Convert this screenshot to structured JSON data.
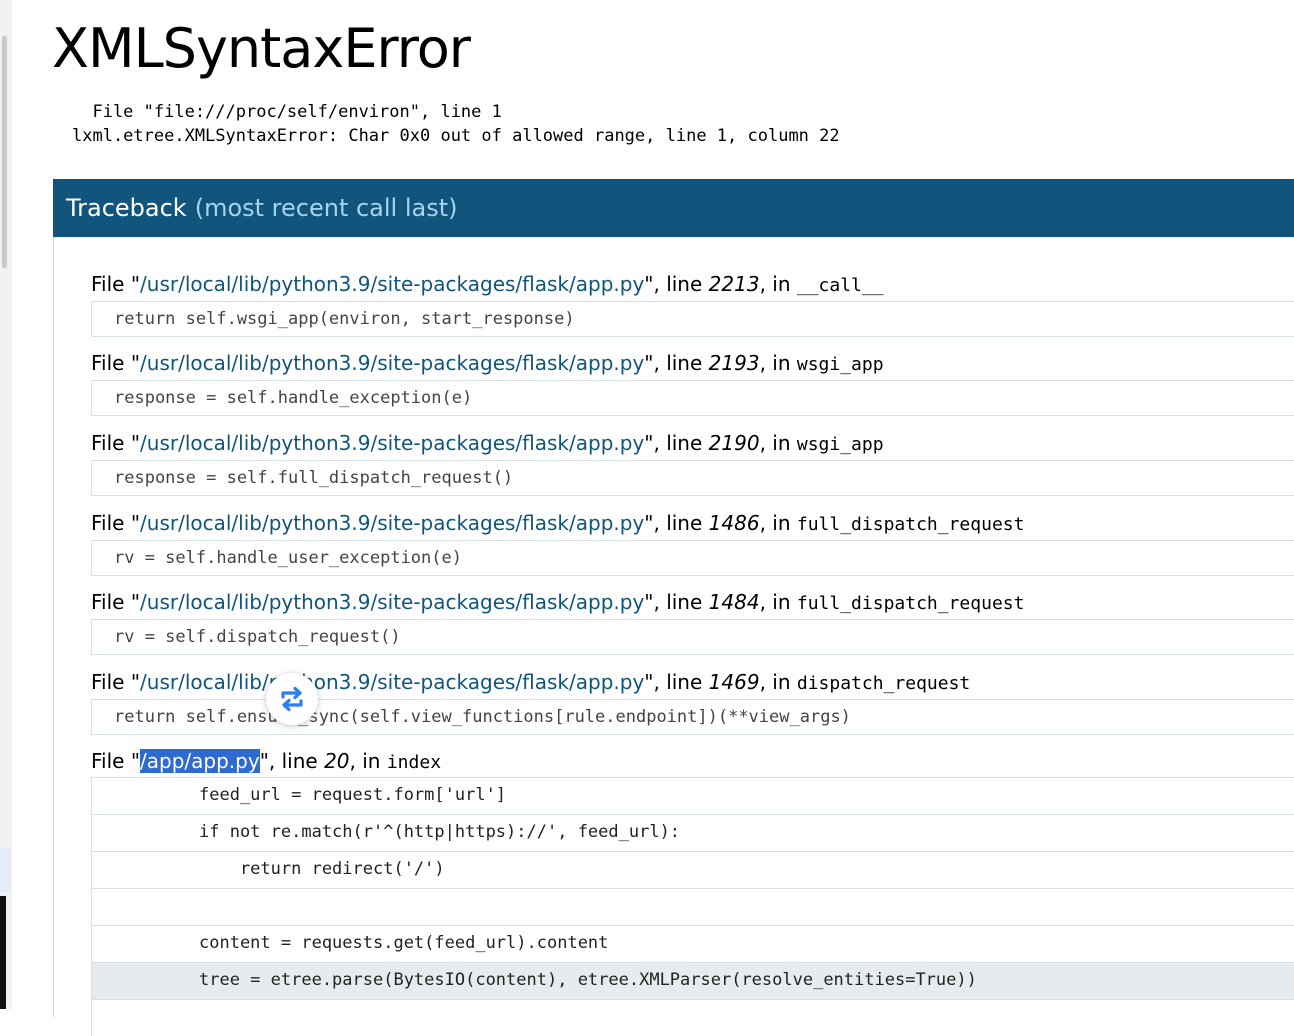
{
  "page": {
    "title": "XMLSyntaxError",
    "summary_file": "  File \"file:///proc/self/environ\", line 1",
    "summary_error": "lxml.etree.XMLSyntaxError: Char 0x0 out of allowed range, line 1, column 22"
  },
  "traceback": {
    "heading": "Traceback",
    "heading_sub": "(most recent call last)",
    "frames": [
      {
        "file_prefix": "File \"",
        "file": "/usr/local/lib/python3.9/site-packages/flask/app.py",
        "line_label": "\", line ",
        "line": "2213",
        "in_label": ", in ",
        "func": "__call__",
        "code": "return self.wsgi_app(environ, start_response)"
      },
      {
        "file_prefix": "File \"",
        "file": "/usr/local/lib/python3.9/site-packages/flask/app.py",
        "line_label": "\", line ",
        "line": "2193",
        "in_label": ", in ",
        "func": "wsgi_app",
        "code": "response = self.handle_exception(e)"
      },
      {
        "file_prefix": "File \"",
        "file": "/usr/local/lib/python3.9/site-packages/flask/app.py",
        "line_label": "\", line ",
        "line": "2190",
        "in_label": ", in ",
        "func": "wsgi_app",
        "code": "response = self.full_dispatch_request()"
      },
      {
        "file_prefix": "File \"",
        "file": "/usr/local/lib/python3.9/site-packages/flask/app.py",
        "line_label": "\", line ",
        "line": "1486",
        "in_label": ", in ",
        "func": "full_dispatch_request",
        "code": "rv = self.handle_user_exception(e)"
      },
      {
        "file_prefix": "File \"",
        "file": "/usr/local/lib/python3.9/site-packages/flask/app.py",
        "line_label": "\", line ",
        "line": "1484",
        "in_label": ", in ",
        "func": "full_dispatch_request",
        "code": "rv = self.dispatch_request()"
      },
      {
        "file_prefix": "File \"",
        "file": "/usr/local/lib/python3.9/site-packages/flask/app.py",
        "line_label": "\", line ",
        "line": "1469",
        "in_label": ", in ",
        "func": "dispatch_request",
        "code": "return self.ensure_sync(self.view_functions[rule.endpoint])(**view_args)"
      }
    ],
    "last_frame": {
      "file_prefix": "File \"",
      "file": "/app/app.py",
      "line_label": "\", line ",
      "line": "20",
      "in_label": ", in ",
      "func": "index",
      "source_lines": [
        "feed_url = request.form['url']",
        "if not re.match(r'^(http|https)://', feed_url):",
        "    return redirect('/')",
        "",
        "content = requests.get(feed_url).content",
        "tree = etree.parse(BytesIO(content), etree.XMLParser(resolve_entities=True))"
      ]
    }
  },
  "colors": {
    "header_bg": "#11557c",
    "header_sub": "#a6d4ee",
    "selection": "#2f6ad1",
    "current_line_bg": "#e6ecee"
  },
  "icons": {
    "floating_button": "swap-arrows-icon"
  }
}
